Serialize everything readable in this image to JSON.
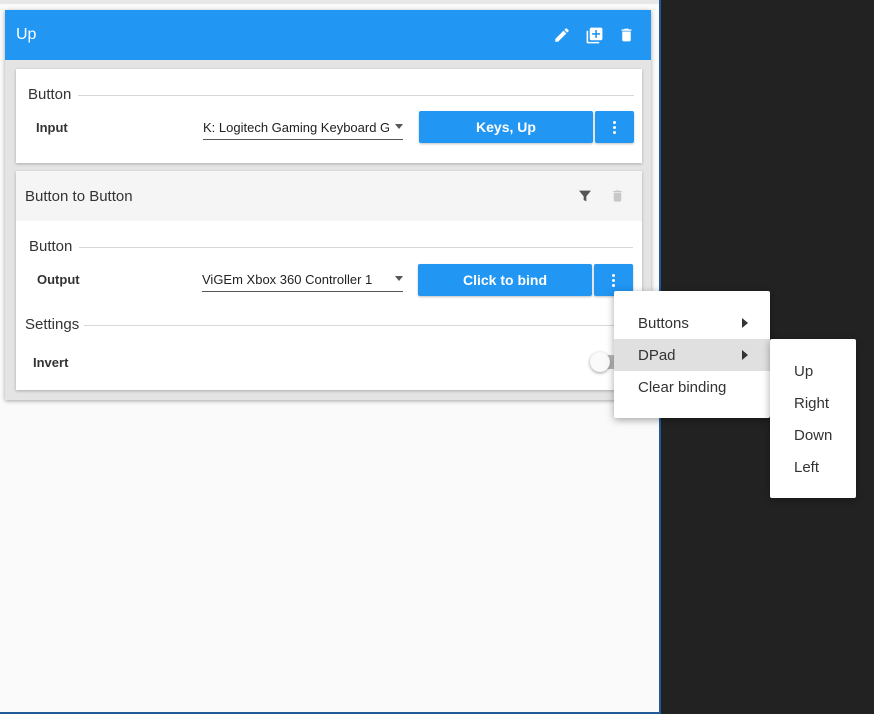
{
  "mapping": {
    "title": "Up",
    "icons": {
      "edit": "pencil-icon",
      "duplicate": "duplicate-icon",
      "delete": "trash-icon"
    }
  },
  "input_panel": {
    "section_title": "Button",
    "field_label": "Input",
    "device_value": "K: Logitech Gaming Keyboard G",
    "bind_button_label": "Keys, Up"
  },
  "filter_panel": {
    "title": "Button to Button",
    "output_section_title": "Button",
    "output_field_label": "Output",
    "output_device_value": "ViGEm Xbox 360 Controller 1",
    "bind_button_label": "Click to bind",
    "settings_section_title": "Settings",
    "invert_label": "Invert",
    "invert_value": false
  },
  "context_menu": {
    "items": [
      {
        "label": "Buttons",
        "has_submenu": true
      },
      {
        "label": "DPad",
        "has_submenu": true,
        "active": true
      },
      {
        "label": "Clear binding",
        "has_submenu": false
      }
    ]
  },
  "submenu": {
    "items": [
      {
        "label": "Up"
      },
      {
        "label": "Right"
      },
      {
        "label": "Down"
      },
      {
        "label": "Left"
      }
    ]
  },
  "colors": {
    "accent": "#2196f3",
    "background_dark": "#222222",
    "window_bg": "#fafafa"
  }
}
